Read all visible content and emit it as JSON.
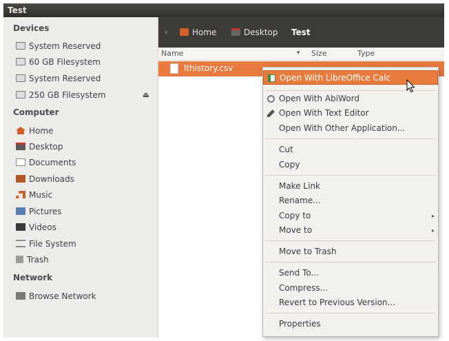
{
  "window": {
    "title": "Test"
  },
  "sidebar": {
    "sections": [
      {
        "heading": "Devices",
        "items": [
          {
            "label": "System Reserved",
            "icon": "drive-icon"
          },
          {
            "label": "60 GB Filesystem",
            "icon": "drive-icon"
          },
          {
            "label": "System Reserved",
            "icon": "drive-icon"
          },
          {
            "label": "250 GB Filesystem",
            "icon": "drive-icon",
            "eject": "⏏"
          }
        ]
      },
      {
        "heading": "Computer",
        "items": [
          {
            "label": "Home",
            "icon": "home-icon"
          },
          {
            "label": "Desktop",
            "icon": "desktop-icon"
          },
          {
            "label": "Documents",
            "icon": "documents-icon"
          },
          {
            "label": "Downloads",
            "icon": "downloads-icon"
          },
          {
            "label": "Music",
            "icon": "music-icon"
          },
          {
            "label": "Pictures",
            "icon": "pictures-icon"
          },
          {
            "label": "Videos",
            "icon": "videos-icon"
          },
          {
            "label": "File System",
            "icon": "filesystem-icon"
          },
          {
            "label": "Trash",
            "icon": "trash-icon"
          }
        ]
      },
      {
        "heading": "Network",
        "items": [
          {
            "label": "Browse Network",
            "icon": "network-icon"
          }
        ]
      }
    ]
  },
  "pathbar": {
    "back_arrow": "‹",
    "crumbs": [
      {
        "label": "Home",
        "icon": "home-folder-icon"
      },
      {
        "label": "Desktop",
        "icon": "desktop-folder-icon"
      },
      {
        "label": "Test",
        "active": true
      }
    ]
  },
  "columns": {
    "name": "Name",
    "sort_indicator": "▾",
    "size": "Size",
    "type": "Type"
  },
  "file": {
    "name": "lthistory.csv",
    "icon": "csv-file-icon"
  },
  "context_menu": {
    "groups": [
      [
        {
          "label": "Open With LibreOffice Calc",
          "icon": "libreoffice-calc-icon",
          "highlighted": true
        },
        {
          "label": "Open With AbiWord",
          "icon": "abiword-icon"
        },
        {
          "label": "Open With Text Editor",
          "icon": "text-editor-icon"
        },
        {
          "label": "Open With Other Application..."
        }
      ],
      [
        {
          "label": "Cut"
        },
        {
          "label": "Copy"
        }
      ],
      [
        {
          "label": "Make Link"
        },
        {
          "label": "Rename..."
        },
        {
          "label": "Copy to",
          "submenu": true
        },
        {
          "label": "Move to",
          "submenu": true
        }
      ],
      [
        {
          "label": "Move to Trash"
        }
      ],
      [
        {
          "label": "Send To..."
        },
        {
          "label": "Compress..."
        },
        {
          "label": "Revert to Previous Version..."
        }
      ],
      [
        {
          "label": "Properties"
        }
      ]
    ],
    "submenu_arrow": "▸"
  },
  "colors": {
    "accent": "#e8793f",
    "pathbar": "#3c3b37",
    "sidebar": "#edece8"
  }
}
